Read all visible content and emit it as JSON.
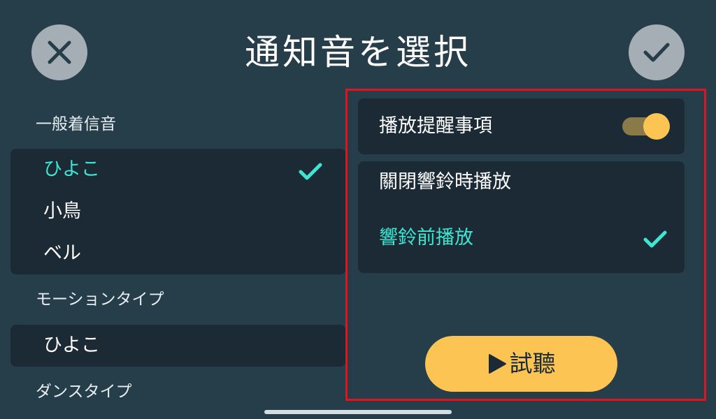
{
  "header": {
    "title": "通知音を選択",
    "close_icon": "close-icon",
    "confirm_icon": "check-icon"
  },
  "sections": {
    "ringtones": {
      "label": "一般着信音",
      "items": [
        {
          "label": "ひよこ",
          "selected": true
        },
        {
          "label": "小鳥",
          "selected": false
        },
        {
          "label": "ベル",
          "selected": false
        }
      ]
    },
    "motion": {
      "label": "モーションタイプ",
      "items": [
        {
          "label": "ひよこ",
          "selected": false
        }
      ]
    },
    "dance": {
      "label": "ダンスタイプ"
    }
  },
  "reminder_panel": {
    "toggle_label": "播放提醒事項",
    "toggle_on": true,
    "options": [
      {
        "label": "關閉響鈴時播放",
        "selected": false
      },
      {
        "label": "響鈴前播放",
        "selected": true
      }
    ],
    "listen_button": {
      "label": "試聽",
      "icon": "play-icon"
    }
  },
  "colors": {
    "background": "#263d4a",
    "panel": "#1b2a34",
    "accent": "#3ee6d2",
    "button_yellow": "#fcc553",
    "highlight_frame": "#e0141d"
  }
}
